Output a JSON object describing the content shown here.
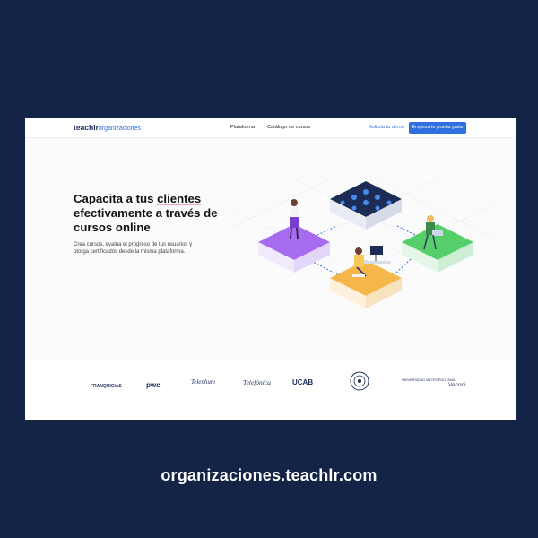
{
  "nav": {
    "logo_main": "teachlr",
    "logo_sub": "organizaciones",
    "links": [
      "Plataforma",
      "Catálogo de cursos"
    ],
    "demo": "Solicita tu demo",
    "cta": "Empieza tu prueba gratis"
  },
  "hero": {
    "headline_part1": "Capacita a tus ",
    "headline_highlight": "clientes",
    "headline_part2": "efectivamente a través de cursos online",
    "subtext": "Crea cursos, evalúa el progreso de tus usuarios y otorga certificados desde la misma plataforma."
  },
  "logos": [
    "FRANQUICIAS",
    "pwc",
    "Telenhum",
    "Telefónica",
    "UCAB",
    "UNIVERSIDAD METROPOLITANA",
    "Veconi"
  ],
  "footer_url": "organizaciones.teachlr.com",
  "colors": {
    "background": "#132447",
    "accent": "#2f6fe0",
    "purple_tile": "#a76bf0",
    "green_tile": "#55cf6a",
    "orange_tile": "#f5b74a",
    "navy_tile": "#1d2c56"
  }
}
